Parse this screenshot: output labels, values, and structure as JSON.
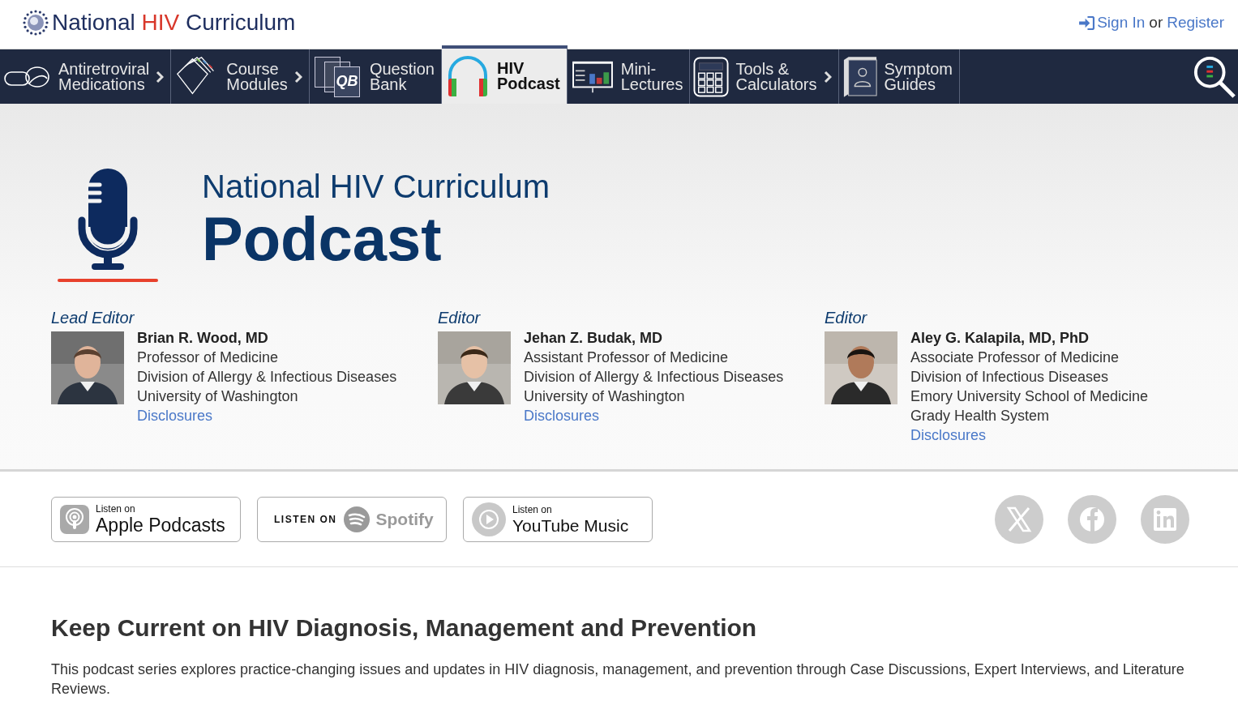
{
  "brand": {
    "before": "National",
    "highlight": "HIV",
    "after": "Curriculum"
  },
  "account": {
    "sign_in": "Sign In",
    "joiner": "or",
    "register": "Register"
  },
  "nav": [
    {
      "kind": "pills",
      "lines": [
        "Antiretroviral",
        "Medications"
      ],
      "has_arrow": true,
      "selected": false
    },
    {
      "kind": "folders",
      "lines": [
        "Course",
        "Modules"
      ],
      "has_arrow": true,
      "selected": false
    },
    {
      "kind": "qb",
      "icon_text": "QB",
      "lines": [
        "Question",
        "Bank"
      ],
      "has_arrow": false,
      "selected": false
    },
    {
      "kind": "headphones",
      "lines": [
        "HIV",
        "Podcast"
      ],
      "has_arrow": false,
      "selected": true
    },
    {
      "kind": "slides",
      "lines": [
        "Mini-",
        "Lectures"
      ],
      "has_arrow": false,
      "selected": false
    },
    {
      "kind": "calculator",
      "lines": [
        "Tools &",
        "Calculators"
      ],
      "has_arrow": true,
      "selected": false
    },
    {
      "kind": "book",
      "lines": [
        "Symptom",
        "Guides"
      ],
      "has_arrow": false,
      "selected": false
    }
  ],
  "hero": {
    "subtitle": "National HIV Curriculum",
    "title": "Podcast"
  },
  "editors": [
    {
      "role": "Lead Editor",
      "name": "Brian R. Wood, MD",
      "lines": [
        "Professor of Medicine",
        "Division of Allergy & Infectious Diseases",
        "University of Washington"
      ],
      "link": "Disclosures",
      "photo": {
        "kind": "picture"
      }
    },
    {
      "role": "Editor",
      "name": "Jehan Z. Budak, MD",
      "lines": [
        "Assistant Professor of Medicine",
        "Division of Allergy & Infectious Diseases",
        "University of Washington"
      ],
      "link": "Disclosures",
      "photo": {
        "kind": "picture"
      }
    },
    {
      "role": "Editor",
      "name": "Aley G. Kalapila, MD, PhD",
      "lines": [
        "Associate Professor of Medicine",
        "Division of Infectious Diseases",
        "Emory University School of Medicine",
        "Grady Health System"
      ],
      "link": "Disclosures",
      "photo": {
        "kind": "picture"
      }
    }
  ],
  "listen": [
    {
      "kind": "apple",
      "small": "Listen on",
      "big": "Apple Podcasts"
    },
    {
      "kind": "spotify",
      "small": "LISTEN ON",
      "big": "Spotify"
    },
    {
      "kind": "youtube",
      "small": "Listen on",
      "big": "YouTube Music"
    }
  ],
  "social": [
    {
      "kind": "x"
    },
    {
      "kind": "facebook"
    },
    {
      "kind": "linkedin"
    }
  ],
  "intro": {
    "heading": "Keep Current on HIV Diagnosis, Management and Prevention",
    "text": "This podcast series explores practice-changing issues and updates in HIV diagnosis, management, and prevention through Case Discussions, Expert Interviews, and Literature Reviews."
  }
}
